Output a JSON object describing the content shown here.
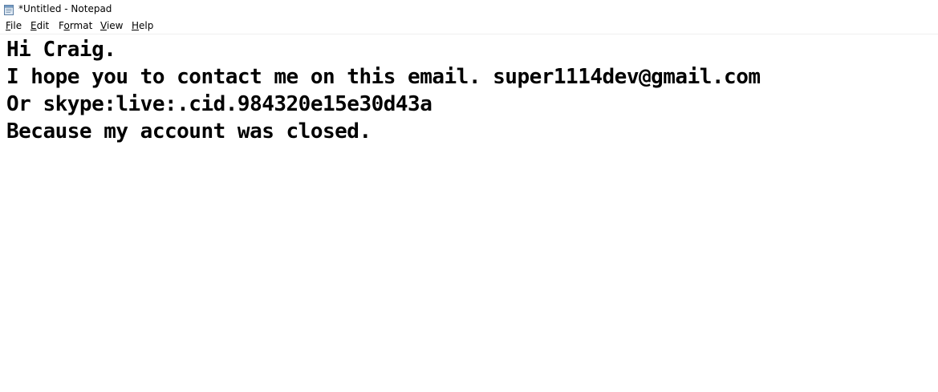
{
  "window": {
    "title": "*Untitled - Notepad",
    "icon": "notepad-icon"
  },
  "menu": {
    "items": [
      {
        "label": "File",
        "mnemonic": "F",
        "rest": "ile"
      },
      {
        "label": "Edit",
        "mnemonic": "E",
        "rest": "dit"
      },
      {
        "label": "Format",
        "mnemonic": "o",
        "pre": "F",
        "rest": "rmat"
      },
      {
        "label": "View",
        "mnemonic": "V",
        "rest": "iew"
      },
      {
        "label": "Help",
        "mnemonic": "H",
        "rest": "elp"
      }
    ]
  },
  "editor": {
    "lines": [
      "Hi Craig.",
      "I hope you to contact me on this email. super1114dev@gmail.com",
      "Or skype:live:.cid.984320e15e30d43a",
      "Because my account was closed."
    ]
  },
  "colors": {
    "background": "#ffffff",
    "text": "#000000"
  }
}
